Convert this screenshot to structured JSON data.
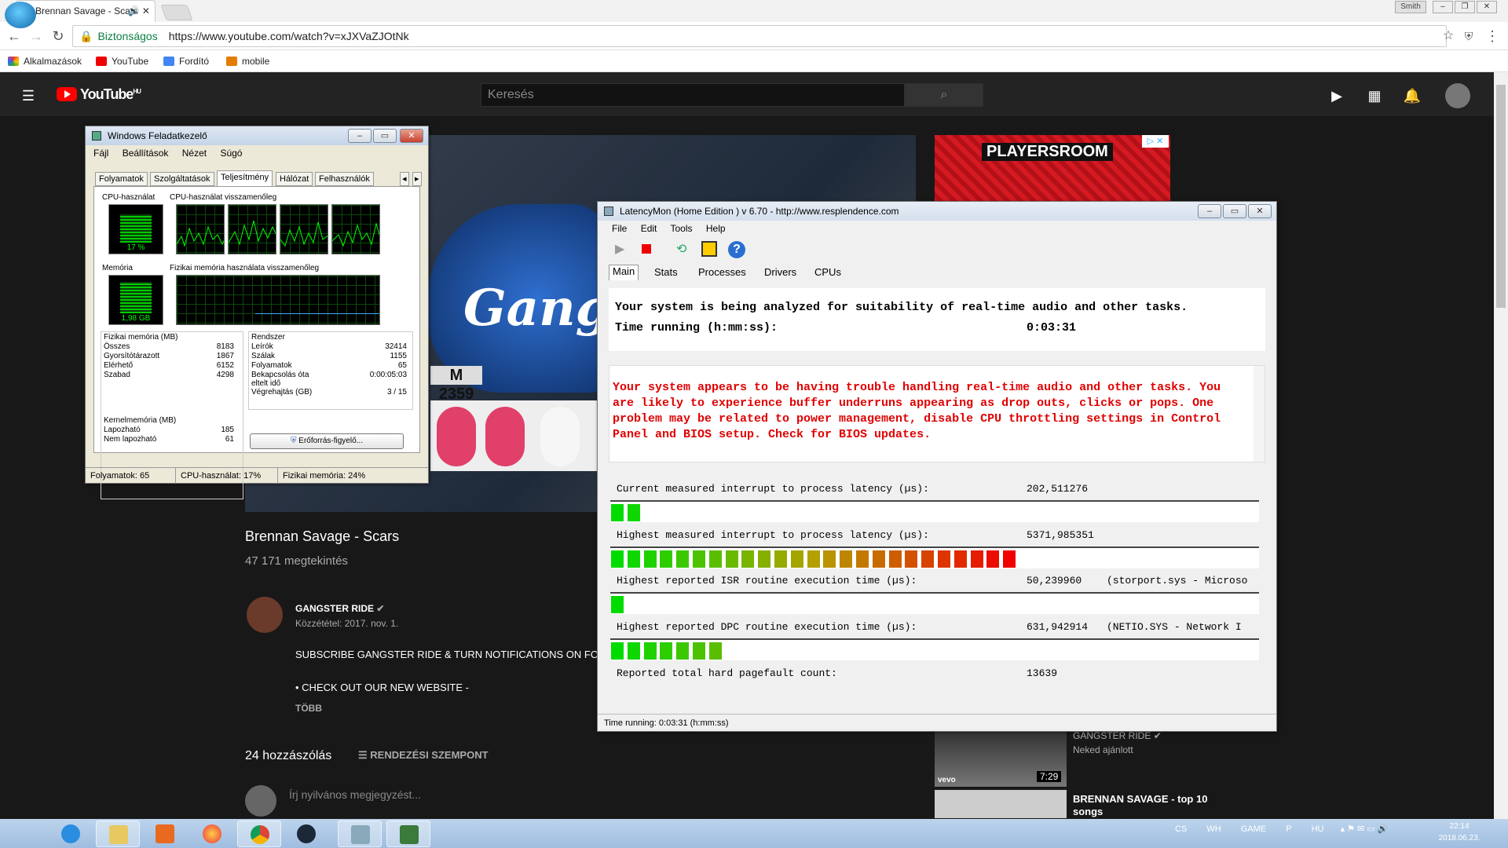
{
  "browser": {
    "tab_title": "Brennan Savage - Scars",
    "user_badge": "Smith",
    "secure_label": "Biztonságos",
    "url": "https://www.youtube.com/watch?v=xJXVaZJOtNk",
    "bookmarks": [
      "Alkalmazások",
      "YouTube",
      "Fordító",
      "mobile"
    ]
  },
  "youtube": {
    "logo_text": "YouTube",
    "logo_region": "HU",
    "search_placeholder": "Keresés",
    "video_title": "Brennan Savage - Scars",
    "views": "47 171 megtekintés",
    "channel_name": "GANGSTER RIDE",
    "published": "Közzététel: 2017. nov. 1.",
    "description_line1": "SUBSCRIBE GANGSTER RIDE & TURN NOTIFICATIONS ON FO",
    "description_line2": "• CHECK OUT OUR NEW WEBSITE -",
    "more_label": "TÖBB",
    "comment_count": "24 hozzászólás",
    "sort_label": "RENDEZÉSI SZEMPONT",
    "comment_placeholder": "Írj nyilvános megjegyzést...",
    "video_overlay_text": "Gang",
    "video_plate": "M 2359",
    "ad_text": "PLAYERSROOM",
    "recommendations": [
      {
        "channel": "GANGSTER RIDE",
        "subtitle": "Neked ajánlott",
        "duration": "7:29",
        "badge": "vevo"
      },
      {
        "title": "BRENNAN SAVAGE - top 10 songs"
      }
    ]
  },
  "taskmanager": {
    "title": "Windows Feladatkezelő",
    "menu": [
      "Fájl",
      "Beállítások",
      "Nézet",
      "Súgó"
    ],
    "tabs": [
      "Folyamatok",
      "Szolgáltatások",
      "Teljesítmény",
      "Hálózat",
      "Felhasználók"
    ],
    "selected_tab": "Teljesítmény",
    "cpu_usage_label": "CPU-használat",
    "cpu_history_label": "CPU-használat visszamenőleg",
    "cpu_value": "17 %",
    "memory_label": "Memória",
    "memory_value": "1,98 GB",
    "mem_history_label": "Fizikai memória használata visszamenőleg",
    "physical_header": "Fizikai memória (MB)",
    "physical": [
      {
        "label": "Összes",
        "value": "8183"
      },
      {
        "label": "Gyorsítótárazott",
        "value": "1867"
      },
      {
        "label": "Elérhető",
        "value": "6152"
      },
      {
        "label": "Szabad",
        "value": "4298"
      }
    ],
    "kernel_header": "Kernelmemória (MB)",
    "kernel": [
      {
        "label": "Lapozható",
        "value": "185"
      },
      {
        "label": "Nem lapozható",
        "value": "61"
      }
    ],
    "system_header": "Rendszer",
    "system": [
      {
        "label": "Leírók",
        "value": "32414"
      },
      {
        "label": "Szálak",
        "value": "1155"
      },
      {
        "label": "Folyamatok",
        "value": "65"
      },
      {
        "label": "Bekapcsolás óta eltelt idő",
        "value": "0:00:05:03"
      },
      {
        "label": "Végrehajtás (GB)",
        "value": "3 / 15"
      }
    ],
    "resmon_button": "Erőforrás-figyelő...",
    "status_processes": "Folyamatok: 65",
    "status_cpu": "CPU-használat: 17%",
    "status_mem": "Fizikai memória: 24%"
  },
  "latencymon": {
    "title": "LatencyMon  (Home Edition )  v 6.70 - http://www.resplendence.com",
    "menu": [
      "File",
      "Edit",
      "Tools",
      "Help"
    ],
    "tabs": [
      "Main",
      "Stats",
      "Processes",
      "Drivers",
      "CPUs"
    ],
    "selected_tab": "Main",
    "header_line1": "Your system is being analyzed for suitability of real-time audio and other tasks.",
    "header_label2": "Time running (h:mm:ss):",
    "header_value2": "0:03:31",
    "warning": "Your system appears to be having trouble handling real-time audio and other tasks. You are likely to experience buffer underruns appearing as drop outs, clicks or pops. One problem may be related to power management, disable CPU throttling settings in Control Panel and BIOS setup. Check for BIOS updates.",
    "warning_color": "#e00000",
    "metrics": [
      {
        "label": "Current measured interrupt to process latency (µs):",
        "value": "202,511276",
        "extra": "",
        "bar_segments": 2
      },
      {
        "label": "Highest measured interrupt to process latency (µs):",
        "value": "5371,985351",
        "extra": "",
        "bar_segments": 25
      },
      {
        "label": "Highest reported ISR routine execution time (µs):",
        "value": "50,239960",
        "extra": "(storport.sys - Microso",
        "bar_segments": 1
      },
      {
        "label": "Highest reported DPC routine execution time (µs):",
        "value": "631,942914",
        "extra": "(NETIO.SYS - Network I",
        "bar_segments": 7
      },
      {
        "label": "Reported total hard pagefault count:",
        "value": "13639",
        "extra": "",
        "bar_segments": 0
      }
    ],
    "status": "Time running: 0:03:31  (h:mm:ss)"
  },
  "taskbar": {
    "tray_labels": [
      "CS",
      "WH",
      "GAME",
      "P",
      "HU"
    ],
    "time": "22:14",
    "date": "2018.06.23."
  }
}
